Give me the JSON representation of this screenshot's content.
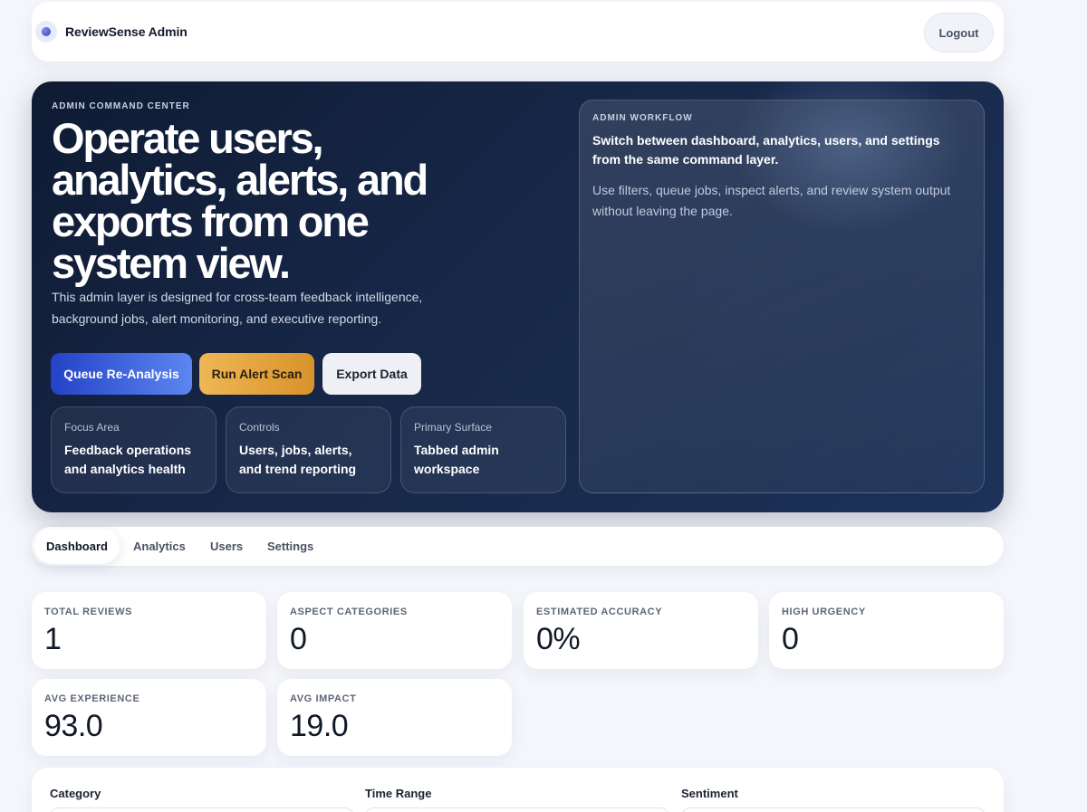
{
  "header": {
    "brand": "ReviewSense Admin",
    "logout": "Logout"
  },
  "hero": {
    "eyebrow": "ADMIN COMMAND CENTER",
    "title": "Operate users, analytics, alerts, and exports from one system view.",
    "description": "This admin layer is designed for cross-team feedback intelligence, background jobs, alert monitoring, and executive reporting.",
    "buttons": {
      "queue": "Queue Re-Analysis",
      "alert": "Run Alert Scan",
      "export": "Export Data"
    },
    "cards": [
      {
        "label": "Focus Area",
        "value": "Feedback operations and analytics health"
      },
      {
        "label": "Controls",
        "value": "Users, jobs, alerts, and trend reporting"
      },
      {
        "label": "Primary Surface",
        "value": "Tabbed admin workspace"
      }
    ],
    "workflow": {
      "eyebrow": "ADMIN WORKFLOW",
      "title": "Switch between dashboard, analytics, users, and settings from the same command layer.",
      "description": "Use filters, queue jobs, inspect alerts, and review system output without leaving the page."
    }
  },
  "tabs": [
    "Dashboard",
    "Analytics",
    "Users",
    "Settings"
  ],
  "stats": [
    {
      "label": "TOTAL REVIEWS",
      "value": "1"
    },
    {
      "label": "ASPECT CATEGORIES",
      "value": "0"
    },
    {
      "label": "ESTIMATED ACCURACY",
      "value": "0%"
    },
    {
      "label": "HIGH URGENCY",
      "value": "0"
    },
    {
      "label": "AVG EXPERIENCE",
      "value": "93.0"
    },
    {
      "label": "AVG IMPACT",
      "value": "19.0"
    }
  ],
  "filters": {
    "category": "Category",
    "time_range": "Time Range",
    "sentiment": "Sentiment"
  }
}
